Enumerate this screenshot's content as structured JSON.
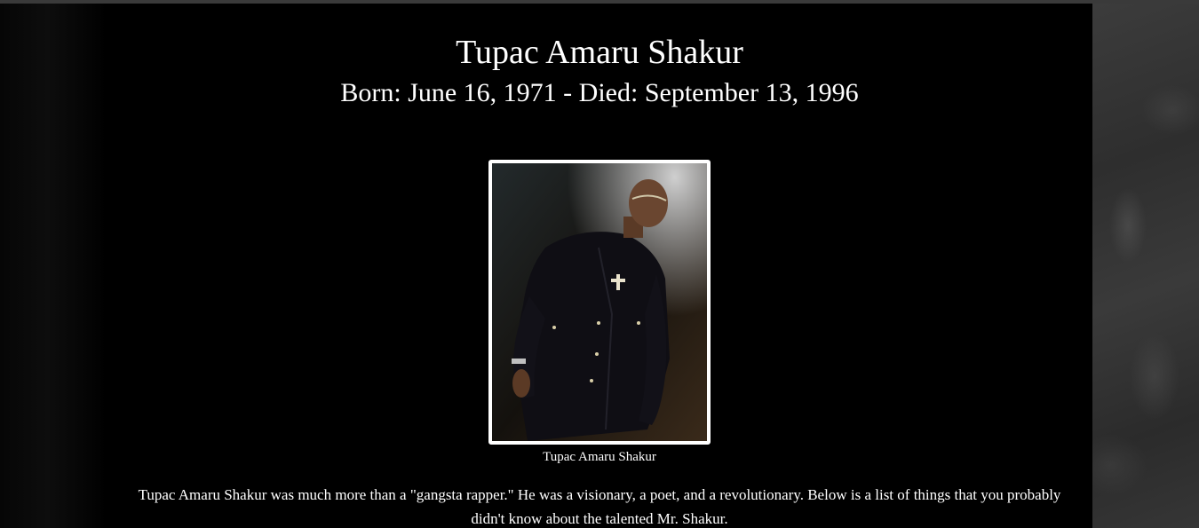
{
  "header": {
    "title": "Tupac Amaru Shakur",
    "subtitle": "Born: June 16, 1971 - Died: September 13, 1996"
  },
  "photo": {
    "caption": "Tupac Amaru Shakur"
  },
  "intro": {
    "text": "Tupac Amaru Shakur was much more than a \"gangsta rapper.\" He was a visionary, a poet, and a revolutionary. Below is a list of things that you probably didn't know about the talented Mr. Shakur."
  },
  "colors": {
    "background": "#000000",
    "text": "#ffffff",
    "side_texture": "#333333"
  }
}
